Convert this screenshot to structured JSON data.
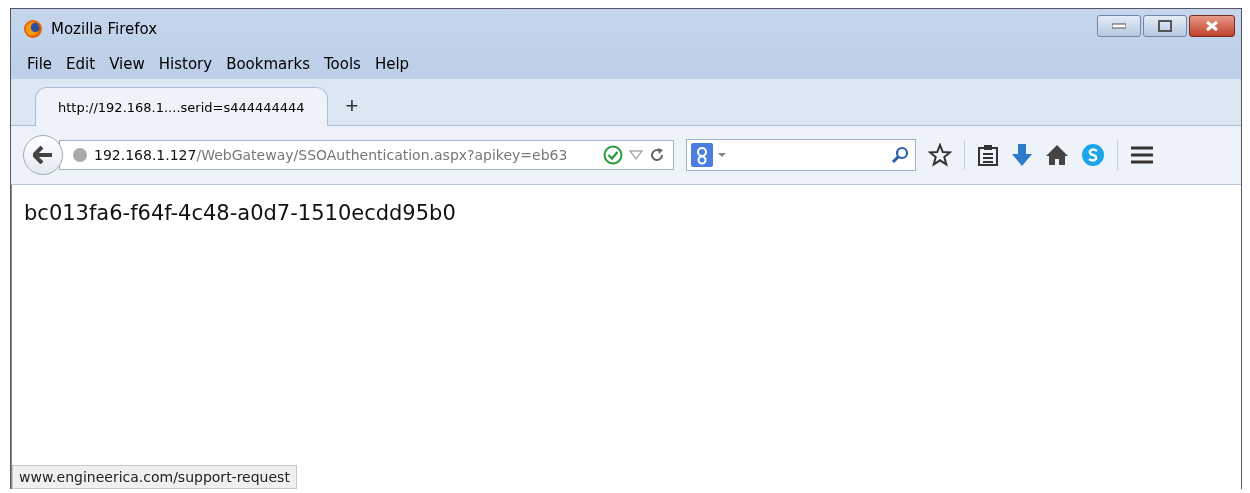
{
  "window": {
    "title": "Mozilla Firefox"
  },
  "menu": [
    "File",
    "Edit",
    "View",
    "History",
    "Bookmarks",
    "Tools",
    "Help"
  ],
  "tabs": [
    {
      "label": "http://192.168.1....serid=s444444444",
      "selected": true
    }
  ],
  "new_tab": "+",
  "address_bar": {
    "host": "192.168.1.127",
    "path": "/WebGateway/SSOAuthentication.aspx?apikey=eb63"
  },
  "page": {
    "text": "bc013fa6-f64f-4c48-a0d7-1510ecdd95b0"
  },
  "status_bar": "www.engineerica.com/support-request"
}
